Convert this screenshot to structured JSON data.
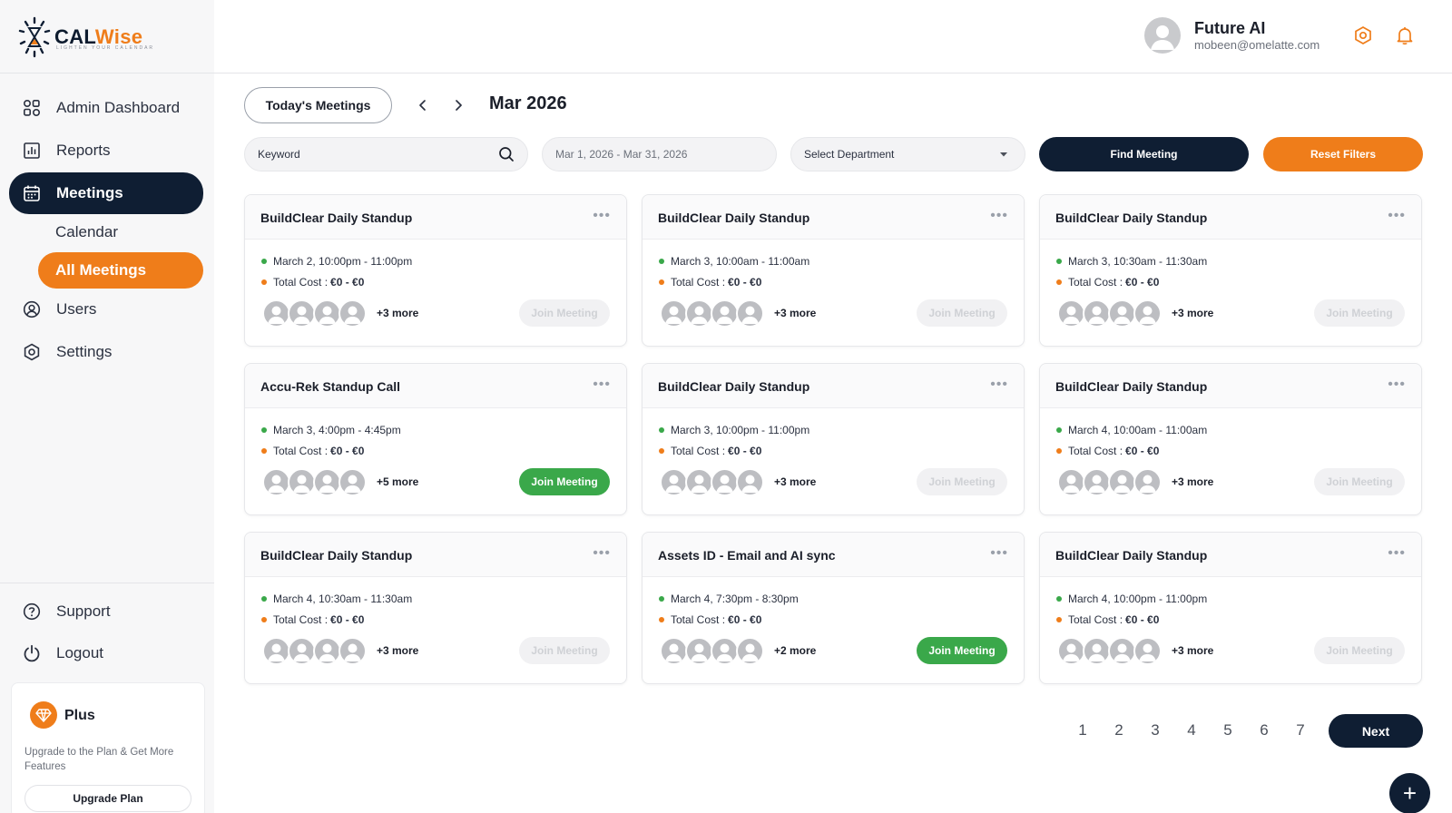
{
  "brand": {
    "name_a": "CAL",
    "name_b": "Wise",
    "tagline": "LIGHTEN YOUR CALENDAR"
  },
  "sidebar": {
    "items": [
      {
        "label": "Admin Dashboard",
        "icon": "grid-icon"
      },
      {
        "label": "Reports",
        "icon": "bar-chart-icon"
      },
      {
        "label": "Meetings",
        "icon": "calendar-icon",
        "active": true
      },
      {
        "label": "Users",
        "icon": "users-icon"
      },
      {
        "label": "Settings",
        "icon": "gear-icon"
      }
    ],
    "sub_items": [
      {
        "label": "Calendar"
      },
      {
        "label": "All Meetings",
        "active": true
      }
    ],
    "bottom_items": [
      {
        "label": "Support",
        "icon": "help-icon"
      },
      {
        "label": "Logout",
        "icon": "power-icon"
      }
    ],
    "plan": {
      "name": "Plus",
      "description": "Upgrade to the Plan & Get More Features",
      "button_label": "Upgrade Plan"
    }
  },
  "header": {
    "user_name": "Future AI",
    "user_email": "mobeen@omelatte.com"
  },
  "toolbar": {
    "today_label": "Today's Meetings",
    "month_label": "Mar 2026",
    "keyword_placeholder": "Keyword",
    "date_range": "Mar 1, 2026 - Mar 31, 2026",
    "department_placeholder": "Select Department",
    "find_label": "Find Meeting",
    "reset_label": "Reset Filters"
  },
  "meetings": [
    {
      "title": "BuildClear Daily Standup",
      "time": "March 2, 10:00pm - 11:00pm",
      "cost_label": "Total Cost :",
      "cost": "€0 - €0",
      "more": "+3 more",
      "join_label": "Join Meeting",
      "join_enabled": false
    },
    {
      "title": "BuildClear Daily Standup",
      "time": "March 3, 10:00am - 11:00am",
      "cost_label": "Total Cost :",
      "cost": "€0 - €0",
      "more": "+3 more",
      "join_label": "Join Meeting",
      "join_enabled": false
    },
    {
      "title": "BuildClear Daily Standup",
      "time": "March 3, 10:30am - 11:30am",
      "cost_label": "Total Cost :",
      "cost": "€0 - €0",
      "more": "+3 more",
      "join_label": "Join Meeting",
      "join_enabled": false
    },
    {
      "title": "Accu-Rek Standup Call",
      "time": "March 3, 4:00pm - 4:45pm",
      "cost_label": "Total Cost :",
      "cost": "€0 - €0",
      "more": "+5 more",
      "join_label": "Join Meeting",
      "join_enabled": true
    },
    {
      "title": "BuildClear Daily Standup",
      "time": "March 3, 10:00pm - 11:00pm",
      "cost_label": "Total Cost :",
      "cost": "€0 - €0",
      "more": "+3 more",
      "join_label": "Join Meeting",
      "join_enabled": false
    },
    {
      "title": "BuildClear Daily Standup",
      "time": "March 4, 10:00am - 11:00am",
      "cost_label": "Total Cost :",
      "cost": "€0 - €0",
      "more": "+3 more",
      "join_label": "Join Meeting",
      "join_enabled": false
    },
    {
      "title": "BuildClear Daily Standup",
      "time": "March 4, 10:30am - 11:30am",
      "cost_label": "Total Cost :",
      "cost": "€0 - €0",
      "more": "+3 more",
      "join_label": "Join Meeting",
      "join_enabled": false
    },
    {
      "title": "Assets ID - Email and AI sync",
      "time": "March 4, 7:30pm - 8:30pm",
      "cost_label": "Total Cost :",
      "cost": "€0 - €0",
      "more": "+2 more",
      "join_label": "Join Meeting",
      "join_enabled": true
    },
    {
      "title": "BuildClear Daily Standup",
      "time": "March 4, 10:00pm - 11:00pm",
      "cost_label": "Total Cost :",
      "cost": "€0 - €0",
      "more": "+3 more",
      "join_label": "Join Meeting",
      "join_enabled": false
    }
  ],
  "pagination": {
    "pages": [
      "1",
      "2",
      "3",
      "4",
      "5",
      "6",
      "7"
    ],
    "next_label": "Next"
  },
  "fab_label": "+",
  "colors": {
    "navy": "#0f1e33",
    "orange": "#ef7d1a",
    "green": "#3aa84a"
  }
}
